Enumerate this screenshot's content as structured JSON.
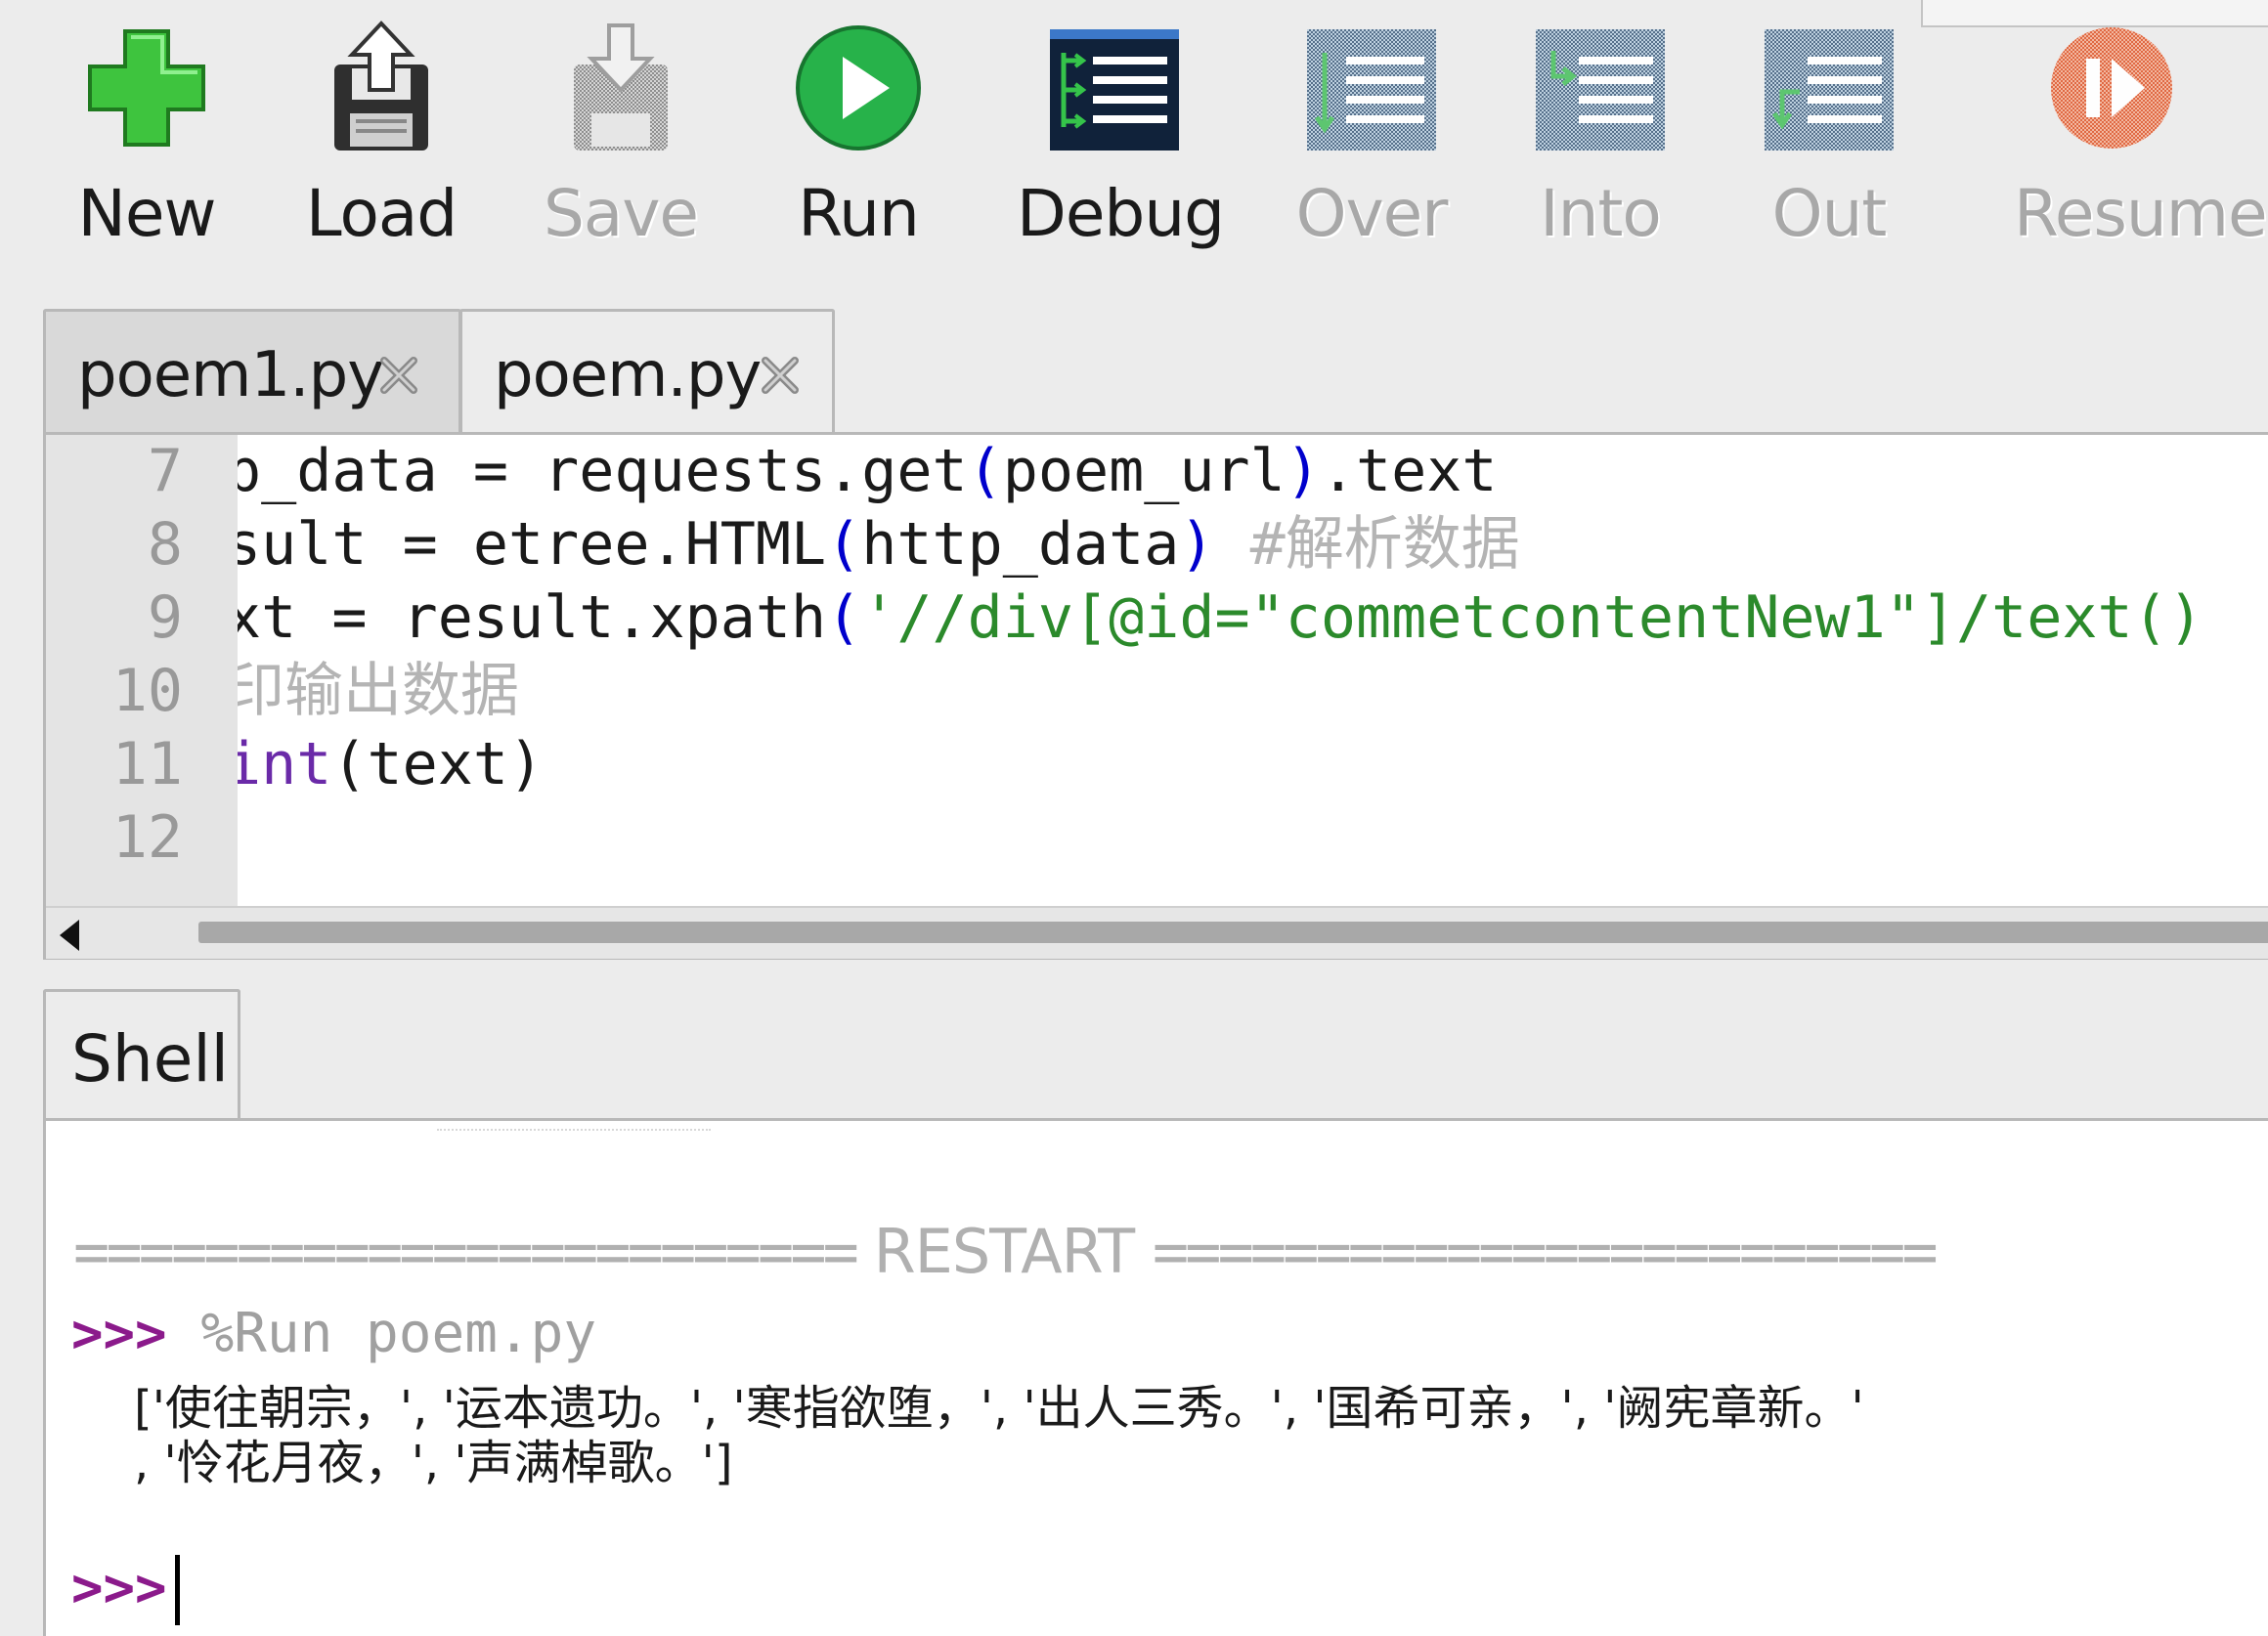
{
  "toolbar": {
    "buttons": [
      {
        "label": "New",
        "icon": "plus-icon",
        "enabled": true
      },
      {
        "label": "Load",
        "icon": "load-floppy-icon",
        "enabled": true
      },
      {
        "label": "Save",
        "icon": "save-floppy-icon",
        "enabled": false
      },
      {
        "label": "Run",
        "icon": "run-play-icon",
        "enabled": true
      },
      {
        "label": "Debug",
        "icon": "debug-icon",
        "enabled": true
      },
      {
        "label": "Over",
        "icon": "step-over-icon",
        "enabled": false
      },
      {
        "label": "Into",
        "icon": "step-into-icon",
        "enabled": false
      },
      {
        "label": "Out",
        "icon": "step-out-icon",
        "enabled": false
      },
      {
        "label": "Resume",
        "icon": "resume-icon",
        "enabled": false
      }
    ]
  },
  "editor": {
    "tabs": [
      {
        "label": "poem1.py",
        "active": false
      },
      {
        "label": "poem.py",
        "active": true
      }
    ],
    "lines": [
      {
        "num": "7",
        "text": "p_data = requests.get(poem_url).text"
      },
      {
        "num": "8",
        "text": "sult = etree.HTML(http_data) #解析数据"
      },
      {
        "num": "9",
        "text": "xt = result.xpath('//div[@id=\"commetcontentNew1\"]/text()"
      },
      {
        "num": "10",
        "text": "印输出数据"
      },
      {
        "num": "11",
        "text": "int(text)"
      },
      {
        "num": "12",
        "text": ""
      }
    ],
    "line7": {
      "a": "p_data = requests.get",
      "b": "(",
      "c": "poem_url",
      "d": ")",
      "e": ".text"
    },
    "line8": {
      "a": "sult = etree.HTML",
      "b": "(",
      "c": "http_data",
      "d": ")",
      "comment": "#解析数据"
    },
    "line9": {
      "a": "xt = result.xpath",
      "b": "(",
      "s": "'//div[@id=\"commetcontentNew1\"]/text()"
    },
    "line10": {
      "comment": "印输出数据"
    },
    "line11": {
      "kw": "int",
      "b": "(",
      "c": "text",
      "d": ")"
    }
  },
  "shell": {
    "tab_label": "Shell",
    "restart_left": "========================",
    "restart_word": "RESTART",
    "restart_right": "========================",
    "prompt": ">>>",
    "command": "%Run poem.py",
    "output_line1": "['使往朝宗，', '运本遗功。', '寒指欲堕，', '出人三秀。', '国希可亲，', '阙宪章新。'",
    "output_line2": ", '怜花月夜，', '声满棹歌。']",
    "input_prompt": ">>>"
  },
  "colors": {
    "prompt": "#8b1a8b",
    "string": "#2b8a2b",
    "paren": "#0000cc",
    "comment": "#b4b4b4",
    "builtin": "#6a2aa8"
  }
}
